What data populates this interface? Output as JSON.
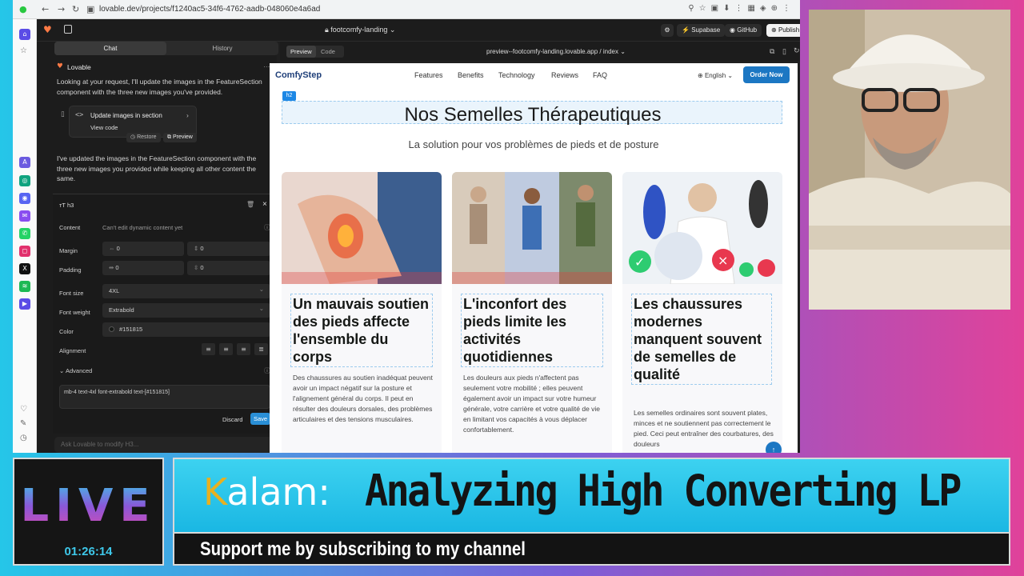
{
  "browser": {
    "url": "lovable.dev/projects/f1240ac5-34f6-4762-aadb-048060e4a6ad"
  },
  "lovable": {
    "project_name": "footcomfy-landing",
    "supabase_label": "Supabase",
    "github_label": "GitHub",
    "publish_label": "Publish"
  },
  "chat": {
    "tabs": [
      "Chat",
      "History"
    ],
    "author": "Lovable",
    "message1": "Looking at your request, I'll update the images in the FeatureSection component with the three new images you've provided.",
    "card_title": "Update images in section",
    "card_link": "View code",
    "restore_label": "Restore",
    "preview_label": "Preview",
    "message2": "I've updated the images in the FeatureSection component with the three new images you provided while keeping all other content the same.",
    "ask_placeholder": "Ask Lovable to modify H3..."
  },
  "editor": {
    "element_tag": "h3",
    "content_label": "Content",
    "content_value": "Can't edit dynamic content yet",
    "margin_label": "Margin",
    "margin_x": "0",
    "margin_y": "0",
    "padding_label": "Padding",
    "padding_x": "0",
    "padding_y": "0",
    "font_size_label": "Font size",
    "font_size_value": "4XL",
    "font_weight_label": "Font weight",
    "font_weight_value": "Extrabold",
    "color_label": "Color",
    "color_value": "#151815",
    "alignment_label": "Alignment",
    "advanced_label": "Advanced",
    "classes": "mb-4 text-4xl font-extrabold text-[#151815]",
    "discard_label": "Discard",
    "save_label": "Save"
  },
  "preview_bar": {
    "preview_tab": "Preview",
    "code_tab": "Code",
    "address": "preview--footcomfy-landing.lovable.app / index"
  },
  "site": {
    "logo": "ComfyStep",
    "nav": [
      "Features",
      "Benefits",
      "Technology",
      "Reviews",
      "FAQ"
    ],
    "language": "English",
    "order_button": "Order Now",
    "h2_tag": "h2",
    "heading": "Nos Semelles Thérapeutiques",
    "subheading": "La solution pour vos problèmes de pieds et de posture",
    "features": [
      {
        "title": "Un mauvais soutien des pieds affecte l'ensemble du corps",
        "text": "Des chaussures au soutien inadéquat peuvent avoir un impact négatif sur la posture et l'alignement général du corps. Il peut en résulter des douleurs dorsales, des problèmes articulaires et des tensions musculaires."
      },
      {
        "title": "L'inconfort des pieds limite les activités quotidiennes",
        "text": "Les douleurs aux pieds n'affectent pas seulement votre mobilité ; elles peuvent également avoir un impact sur votre humeur générale, votre carrière et votre qualité de vie en limitant vos capacités à vous déplacer confortablement."
      },
      {
        "title": "Les chaussures modernes manquent souvent de semelles de qualité",
        "text": "Les semelles ordinaires sont souvent plates, minces et ne soutiennent pas correctement le pied. Ceci peut entraîner des courbatures, des douleurs"
      }
    ]
  },
  "overlay": {
    "live_label": "LIVE",
    "timer": "01:26:14",
    "brand": "Kalam:",
    "title": "Analyzing High Converting LP",
    "subtitle": "Support me by subscribing to my channel"
  }
}
